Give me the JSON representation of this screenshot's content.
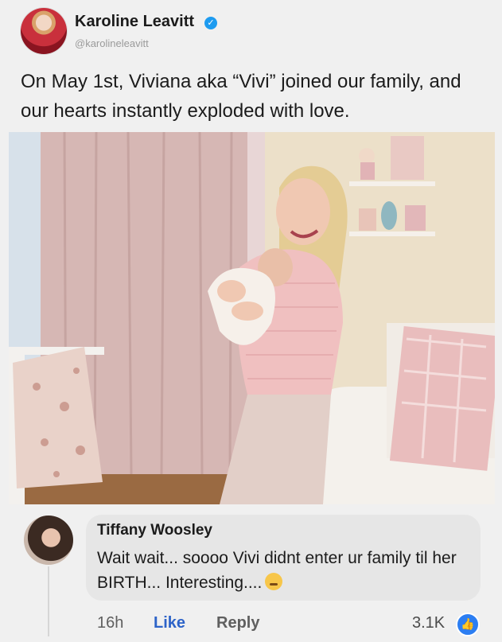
{
  "post": {
    "author_name": "Karoline Leavitt",
    "verified_icon": "✓",
    "handle": "@karolineleavitt",
    "text": "On May 1st, Viviana aka “Vivi” joined our family, and our hearts instantly exploded with love."
  },
  "comment": {
    "author_name": "Tiffany Woosley",
    "text": "Wait wait... soooo Vivi didnt enter ur family til her BIRTH... Interesting....",
    "emoji": "thinking-face-icon",
    "time": "16h",
    "like_label": "Like",
    "reply_label": "Reply",
    "reaction_count": "3.1K",
    "reaction_icon_glyph": "👍"
  },
  "colors": {
    "background": "#f0f0f0",
    "verified_blue": "#1d9bf0",
    "like_blue": "#2d63c8",
    "comment_bubble": "#e6e6e6"
  }
}
